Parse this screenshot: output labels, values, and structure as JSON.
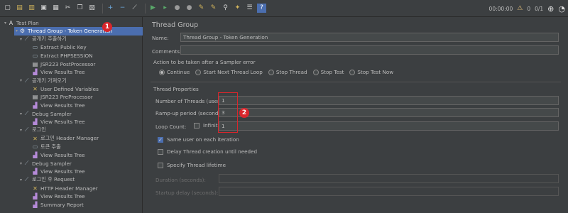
{
  "toolbar": {
    "icons": [
      "new-icon",
      "templates-icon",
      "open-icon",
      "save-icon",
      "save-as-icon",
      "cut-icon",
      "copy-icon",
      "paste-icon",
      "expand-icon",
      "collapse-icon",
      "toggle-icon",
      "start-icon",
      "start-no-pause-icon",
      "stop-icon",
      "shutdown-icon",
      "clear-icon",
      "clear-all-icon",
      "search-icon",
      "reset-search-icon",
      "function-helper-icon",
      "help-icon"
    ],
    "timer": "00:00:00",
    "warn_count": "0",
    "threads": "0/1"
  },
  "tree": {
    "nodes": [
      {
        "label": "Test Plan",
        "level": 0,
        "icon": "test-plan-icon",
        "twist": "▾"
      },
      {
        "label": "Thread Group - Token Generation",
        "level": 1,
        "icon": "thread-group-icon",
        "twist": "▾",
        "selected": true
      },
      {
        "label": "공개키 추출하기",
        "level": 2,
        "icon": "http-sampler-icon",
        "twist": "▾"
      },
      {
        "label": "Extract Public Key",
        "level": 3,
        "icon": "extractor-icon",
        "twist": ""
      },
      {
        "label": "Extract PHPSESSION",
        "level": 3,
        "icon": "extractor-icon",
        "twist": ""
      },
      {
        "label": "JSR223 PostProcessor",
        "level": 3,
        "icon": "script-icon",
        "twist": ""
      },
      {
        "label": "View Results Tree",
        "level": 3,
        "icon": "listener-icon",
        "twist": ""
      },
      {
        "label": "공개키 가져오기",
        "level": 2,
        "icon": "http-sampler-icon",
        "twist": "▾"
      },
      {
        "label": "User Defined Variables",
        "level": 3,
        "icon": "config-icon",
        "twist": ""
      },
      {
        "label": "JSR223 PreProcessor",
        "level": 3,
        "icon": "script-icon",
        "twist": ""
      },
      {
        "label": "View Results Tree",
        "level": 3,
        "icon": "listener-icon",
        "twist": ""
      },
      {
        "label": "Debug Sampler",
        "level": 2,
        "icon": "http-sampler-icon",
        "twist": "▾"
      },
      {
        "label": "View Results Tree",
        "level": 3,
        "icon": "listener-icon",
        "twist": ""
      },
      {
        "label": "로그인",
        "level": 2,
        "icon": "http-sampler-icon",
        "twist": "▾"
      },
      {
        "label": "로그인 Header Manager",
        "level": 3,
        "icon": "config-icon",
        "twist": ""
      },
      {
        "label": "토큰 추출",
        "level": 3,
        "icon": "extractor-icon",
        "twist": ""
      },
      {
        "label": "View Results Tree",
        "level": 3,
        "icon": "listener-icon",
        "twist": ""
      },
      {
        "label": "Debug Sampler",
        "level": 2,
        "icon": "http-sampler-icon",
        "twist": "▾"
      },
      {
        "label": "View Results Tree",
        "level": 3,
        "icon": "listener-icon",
        "twist": ""
      },
      {
        "label": "로그인 후 Request",
        "level": 2,
        "icon": "http-sampler-icon",
        "twist": "▾"
      },
      {
        "label": "HTTP Header Manager",
        "level": 3,
        "icon": "config-icon",
        "twist": ""
      },
      {
        "label": "View Results Tree",
        "level": 3,
        "icon": "listener-icon",
        "twist": ""
      },
      {
        "label": "Summary Report",
        "level": 3,
        "icon": "listener-icon",
        "twist": ""
      }
    ]
  },
  "annotations": {
    "one": "1",
    "two": "2"
  },
  "panel": {
    "title": "Thread Group",
    "name_label": "Name:",
    "name_value": "Thread Group - Token Generation",
    "comments_label": "Comments:",
    "comments_value": "",
    "error_section": "Action to be taken after a Sampler error",
    "error_options": [
      {
        "label": "Continue",
        "selected": true
      },
      {
        "label": "Start Next Thread Loop",
        "selected": false
      },
      {
        "label": "Stop Thread",
        "selected": false
      },
      {
        "label": "Stop Test",
        "selected": false
      },
      {
        "label": "Stop Test Now",
        "selected": false
      }
    ],
    "props_section": "Thread Properties",
    "threads_label": "Number of Threads (users):",
    "threads_value": "1",
    "rampup_label": "Ramp-up period (seconds):",
    "rampup_value": "3",
    "loop_label": "Loop Count:",
    "infinite_label": "Infinite",
    "loop_value": "1",
    "same_user_label": "Same user on each iteration",
    "delay_label": "Delay Thread creation until needed",
    "lifetime_label": "Specify Thread lifetime",
    "duration_label": "Duration (seconds):",
    "startup_label": "Startup delay (seconds):"
  },
  "colors": {
    "accent": "#4b6eaf",
    "annotation": "#d9262c",
    "background": "#3c3f41"
  }
}
